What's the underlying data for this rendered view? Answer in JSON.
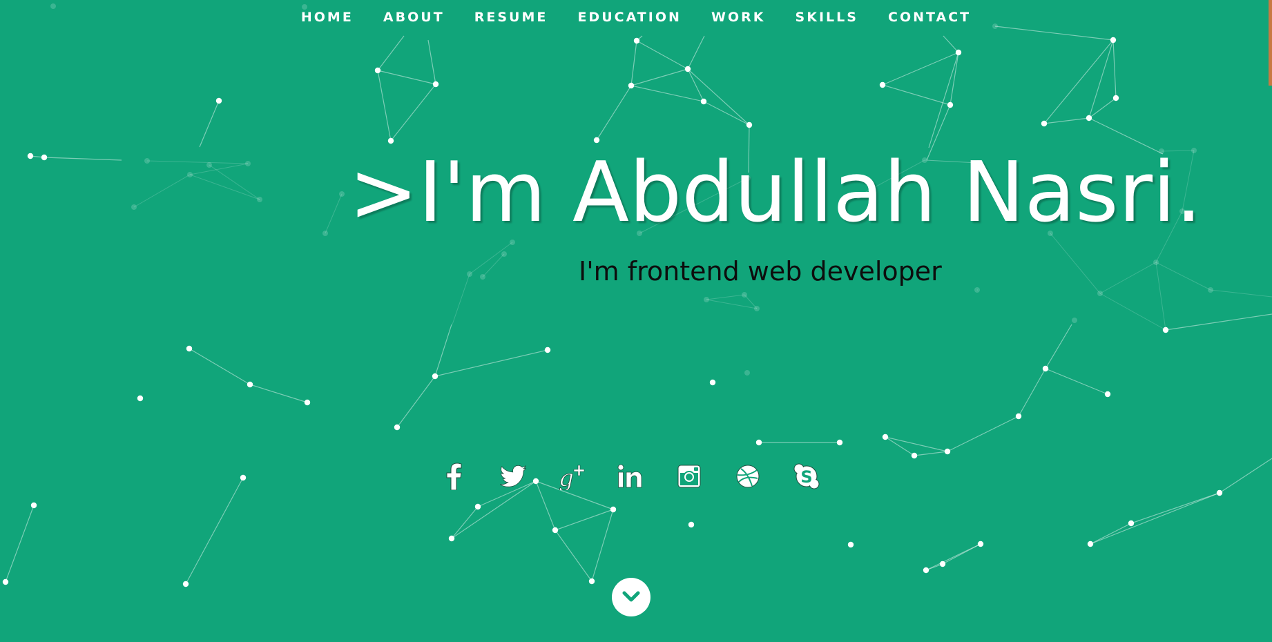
{
  "nav": {
    "items": [
      {
        "label": "HOME"
      },
      {
        "label": "ABOUT"
      },
      {
        "label": "RESUME"
      },
      {
        "label": "EDUCATION"
      },
      {
        "label": "WORK"
      },
      {
        "label": "SKILLS"
      },
      {
        "label": "CONTACT"
      }
    ]
  },
  "hero": {
    "title": ">I'm Abdullah Nasri.",
    "subtitle": "I'm frontend web developer"
  },
  "social": [
    {
      "icon": "facebook-icon"
    },
    {
      "icon": "twitter-icon"
    },
    {
      "icon": "google-plus-icon"
    },
    {
      "icon": "linkedin-icon"
    },
    {
      "icon": "instagram-icon"
    },
    {
      "icon": "dribbble-icon"
    },
    {
      "icon": "skype-icon"
    }
  ],
  "scroll_down": {
    "icon": "chevron-down-icon"
  },
  "colors": {
    "background": "#11a57a",
    "text": "#ffffff",
    "subtitle": "#0d0d0d",
    "scroll_indicator": "#c87942"
  }
}
